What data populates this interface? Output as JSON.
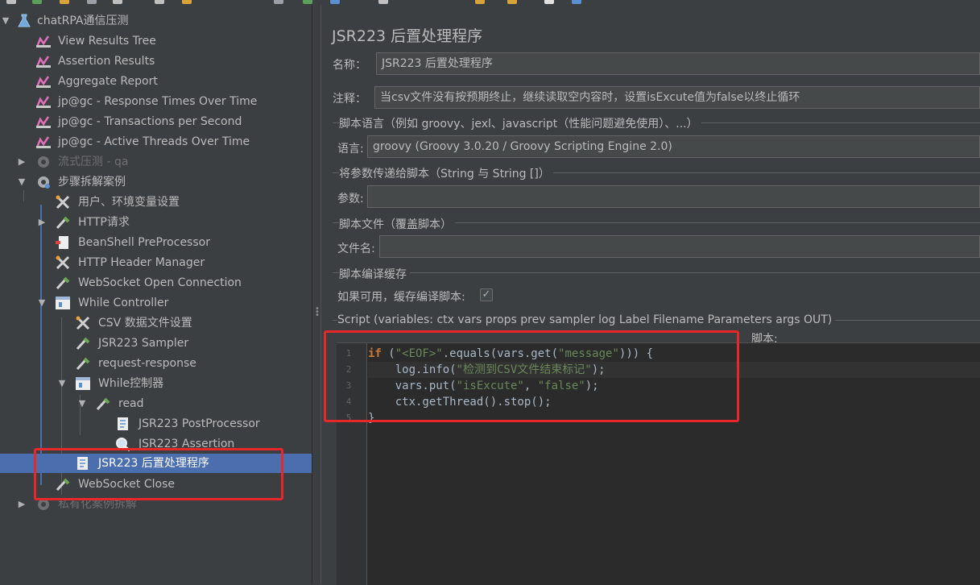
{
  "tree": {
    "items": [
      {
        "label": "chatRPA通信压测",
        "icon": "flask-icon"
      },
      {
        "label": "View Results Tree",
        "icon": "listener-icon"
      },
      {
        "label": "Assertion Results",
        "icon": "listener-icon"
      },
      {
        "label": "Aggregate Report",
        "icon": "listener-icon"
      },
      {
        "label": "jp@gc - Response Times Over Time",
        "icon": "listener-icon"
      },
      {
        "label": "jp@gc - Transactions per Second",
        "icon": "listener-icon"
      },
      {
        "label": "jp@gc - Active Threads Over Time",
        "icon": "listener-icon"
      },
      {
        "label": "流式压测 - qa",
        "icon": "gear-icon",
        "disabled": true
      },
      {
        "label": "步骤拆解案例",
        "icon": "gear-icon"
      },
      {
        "label": "用户、环境变量设置",
        "icon": "wrench-icon"
      },
      {
        "label": "HTTP请求",
        "icon": "pipette-icon"
      },
      {
        "label": "BeanShell PreProcessor",
        "icon": "preprocessor-icon"
      },
      {
        "label": "HTTP Header Manager",
        "icon": "wrench-icon"
      },
      {
        "label": "WebSocket Open Connection",
        "icon": "pipette-icon"
      },
      {
        "label": "While Controller",
        "icon": "controller-icon"
      },
      {
        "label": "CSV 数据文件设置",
        "icon": "wrench-icon"
      },
      {
        "label": "JSR223 Sampler",
        "icon": "pipette-icon"
      },
      {
        "label": "request-response",
        "icon": "pipette-icon"
      },
      {
        "label": "While控制器",
        "icon": "controller-icon"
      },
      {
        "label": "read",
        "icon": "pipette-icon"
      },
      {
        "label": "JSR223 PostProcessor",
        "icon": "script-icon"
      },
      {
        "label": "JSR223 Assertion",
        "icon": "magnifier-icon"
      },
      {
        "label": "JSR223 后置处理程序",
        "icon": "script-icon",
        "selected": true
      },
      {
        "label": "WebSocket Close",
        "icon": "pipette-icon"
      },
      {
        "label": "私有化案例拆解",
        "icon": "gear-icon",
        "disabled": true
      }
    ]
  },
  "panel": {
    "title": "JSR223 后置处理程序",
    "name_label": "名称：",
    "name_value": "JSR223 后置处理程序",
    "comment_label": "注释：",
    "comment_value": "当csv文件没有按预期终止，继续读取空内容时，设置isExcute值为false以终止循环",
    "script_lang_section": "脚本语言（例如 groovy、jexl、javascript（性能问题避免使用）、...）",
    "language_label": "语言:",
    "language_value": "groovy     (Groovy 3.0.20 / Groovy Scripting Engine 2.0)",
    "params_section": "将参数传递给脚本（String 与 String []）",
    "params_label": "参数:",
    "params_value": "",
    "file_section": "脚本文件（覆盖脚本）",
    "filename_label": "文件名:",
    "filename_value": "",
    "cache_section": "脚本编译缓存",
    "cache_label": "如果可用，缓存编译脚本:",
    "cache_checked": "✓",
    "script_section": "Script (variables: ctx vars props prev sampler log Label Filename Parameters args OUT)",
    "script_label": "脚本:"
  },
  "code": {
    "line_numbers": [
      "1",
      "2",
      "3",
      "4",
      "5"
    ],
    "lines": [
      [
        {
          "t": "kw",
          "v": "if"
        },
        {
          "t": "plain",
          "v": " ("
        },
        {
          "t": "str",
          "v": "\"<EOF>\""
        },
        {
          "t": "plain",
          "v": ".equals(vars.get("
        },
        {
          "t": "str",
          "v": "\"message\""
        },
        {
          "t": "plain",
          "v": "))) {"
        }
      ],
      [
        {
          "t": "plain",
          "v": "    log.info("
        },
        {
          "t": "str",
          "v": "\"检测到CSV文件结束标记\""
        },
        {
          "t": "plain",
          "v": ");"
        }
      ],
      [
        {
          "t": "plain",
          "v": "    vars.put("
        },
        {
          "t": "str",
          "v": "\"isExcute\""
        },
        {
          "t": "plain",
          "v": ", "
        },
        {
          "t": "str",
          "v": "\"false\""
        },
        {
          "t": "plain",
          "v": ");"
        }
      ],
      [
        {
          "t": "plain",
          "v": "    ctx.getThread().stop();"
        }
      ],
      [
        {
          "t": "plain",
          "v": "}"
        }
      ]
    ]
  },
  "colors": {
    "background": "#3c3f41",
    "selection": "#4b6eaf",
    "highlight_box": "#e8272b",
    "keyword": "#cc7832",
    "string": "#6a8759"
  }
}
